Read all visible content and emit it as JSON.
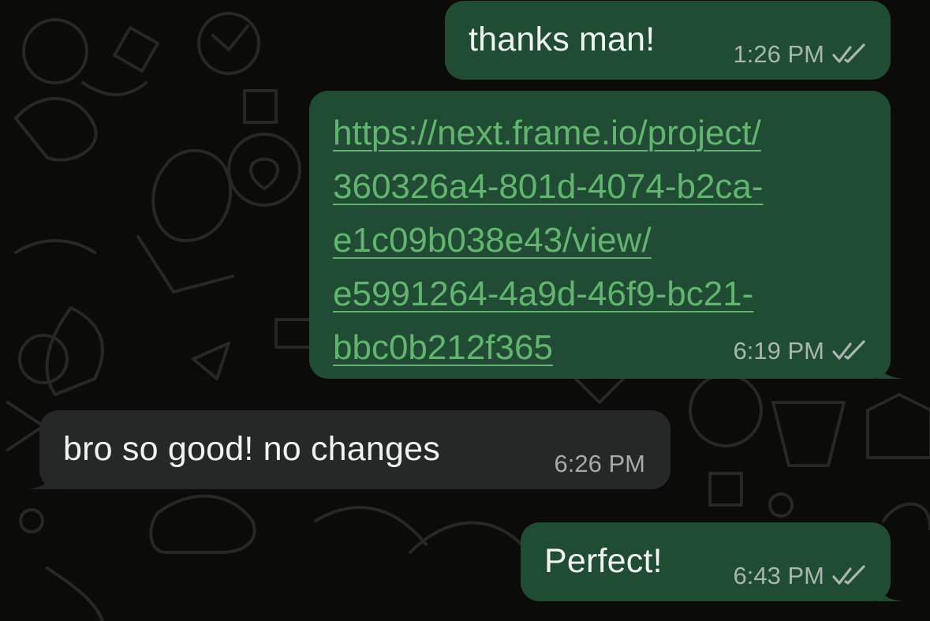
{
  "conversation": {
    "messages": [
      {
        "direction": "outgoing",
        "text": "thanks man!",
        "time": "1:26 PM",
        "status": "read"
      },
      {
        "direction": "outgoing",
        "text": "https://next.frame.io/project/360326a4-801d-4074-b2ca-e1c09b038e43/view/e5991264-4a9d-46f9-bc21-bbc0b212f365",
        "link_lines": [
          "https://next.frame.io/project/",
          "360326a4-801d-4074-b2ca-",
          "e1c09b038e43/view/",
          "e5991264-4a9d-46f9-bc21-",
          "bbc0b212f365"
        ],
        "time": "6:19 PM",
        "status": "read"
      },
      {
        "direction": "incoming",
        "text": "bro so good! no changes",
        "time": "6:26 PM"
      },
      {
        "direction": "outgoing",
        "text": "Perfect!",
        "time": "6:43 PM",
        "status": "read"
      }
    ]
  },
  "colors": {
    "background": "#0b0b0a",
    "outgoing_bubble": "#1f4c33",
    "incoming_bubble": "#262727",
    "link": "#62b56f",
    "read_ticks": "#a8b7ae"
  },
  "icons": {
    "read_receipt": "double-check-icon"
  }
}
